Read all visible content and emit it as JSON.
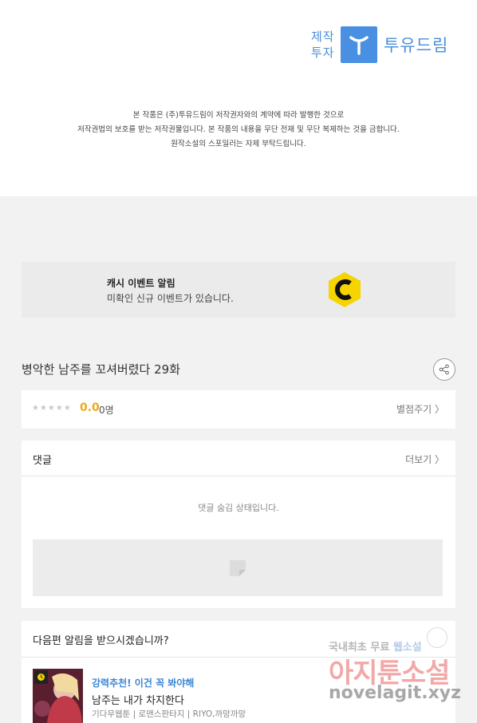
{
  "producer": {
    "label": "제작\n투자",
    "name": "투유드림"
  },
  "notice": [
    "본 작품은 (주)투유드림이 저작권자와의 계약에 따라 발행한 것으로",
    "저작권법의 보호를 받는 저작권물입니다. 본 작품의 내용을 무단 전재 및 무단 복제하는 것을 금합니다.",
    "원작소설의 스포일러는 자제 부탁드립니다."
  ],
  "cash_event": {
    "title": "캐시 이벤트 알림",
    "description": "미확인 신규 이벤트가 있습니다.",
    "icon": "cash-coin-icon",
    "coin_color": "#f5d400"
  },
  "episode": {
    "title": "병악한 남주를 꼬셔버렸다 29화"
  },
  "rating": {
    "stars": "★★★★★",
    "score": "0.0",
    "people": "0명",
    "rate_button": "별점주기 〉"
  },
  "comments": {
    "title": "댓글",
    "more": "더보기 〉",
    "empty_text": "댓글 숨김 상태입니다."
  },
  "next_alert": {
    "title": "다음편 알림을 받으시겠습니까?",
    "promo": "강력추천! 이건 꼭 봐야해",
    "work_title": "남주는 내가 차지한다",
    "meta": "기다무웹툰 | 로맨스판타지 | RIYO,까망까망"
  },
  "watermark": {
    "line1_a": "국내최초 무료 ",
    "line1_b": "웹소설",
    "line2": "아지툰소설",
    "line3": "novelagit.xyz"
  }
}
